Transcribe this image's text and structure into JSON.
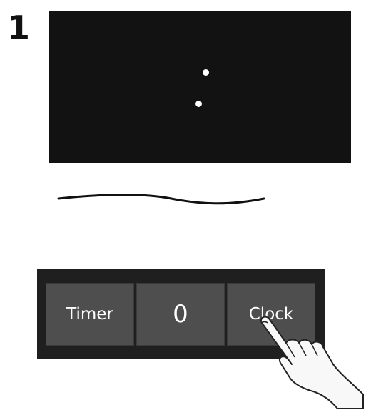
{
  "step": {
    "number": "1"
  },
  "display": {
    "icon": "colon-separator"
  },
  "controls": {
    "timer_label": "Timer",
    "count_value": "0",
    "clock_label": "Clock"
  },
  "pointer": {
    "icon": "pointing-hand-icon"
  }
}
